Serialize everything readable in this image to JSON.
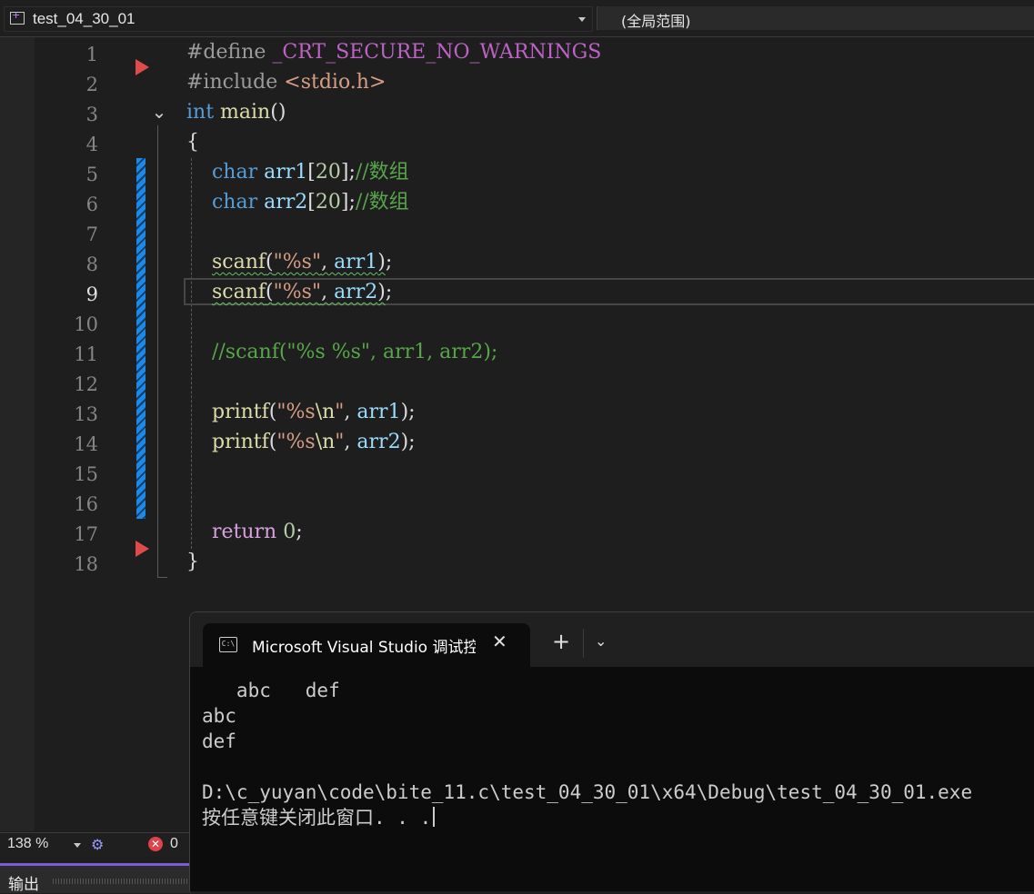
{
  "navbar": {
    "project": "test_04_30_01",
    "scope": "(全局范围)"
  },
  "editor": {
    "line_numbers": [
      "1",
      "2",
      "3",
      "4",
      "5",
      "6",
      "7",
      "8",
      "9",
      "10",
      "11",
      "12",
      "13",
      "14",
      "15",
      "16",
      "17",
      "18"
    ],
    "current_line": "9",
    "lines": [
      [
        {
          "t": "#define ",
          "c": "pp"
        },
        {
          "t": "_CRT_SECURE_NO_WARNINGS",
          "c": "macro"
        }
      ],
      [
        {
          "t": "#include ",
          "c": "pp"
        },
        {
          "t": "<stdio.h>",
          "c": "str"
        }
      ],
      [
        {
          "t": "int",
          "c": "kw"
        },
        {
          "t": " "
        },
        {
          "t": "main",
          "c": "fn"
        },
        {
          "t": "()"
        }
      ],
      [
        {
          "t": "{"
        }
      ],
      [
        {
          "t": "    "
        },
        {
          "t": "char",
          "c": "kw"
        },
        {
          "t": " "
        },
        {
          "t": "arr1",
          "c": "var"
        },
        {
          "t": "["
        },
        {
          "t": "20",
          "c": "num"
        },
        {
          "t": "];"
        },
        {
          "t": "//数组",
          "c": "cmt"
        }
      ],
      [
        {
          "t": "    "
        },
        {
          "t": "char",
          "c": "kw"
        },
        {
          "t": " "
        },
        {
          "t": "arr2",
          "c": "var"
        },
        {
          "t": "["
        },
        {
          "t": "20",
          "c": "num"
        },
        {
          "t": "];"
        },
        {
          "t": "//数组",
          "c": "cmt"
        }
      ],
      [],
      [
        {
          "t": "    "
        },
        {
          "t": "scanf",
          "c": "fn squig"
        },
        {
          "t": "(",
          "c": "squig"
        },
        {
          "t": "\"%s\"",
          "c": "str squig"
        },
        {
          "t": ", ",
          "c": "squig"
        },
        {
          "t": "arr1",
          "c": "var squig"
        },
        {
          "t": ")",
          "c": "squig"
        },
        {
          "t": ";"
        }
      ],
      [
        {
          "t": "    "
        },
        {
          "t": "scanf",
          "c": "fn squig"
        },
        {
          "t": "(",
          "c": "squig"
        },
        {
          "t": "\"%s\"",
          "c": "str squig"
        },
        {
          "t": ", ",
          "c": "squig"
        },
        {
          "t": "arr2",
          "c": "var squig"
        },
        {
          "t": ")",
          "c": "squig"
        },
        {
          "t": ";"
        }
      ],
      [],
      [
        {
          "t": "    "
        },
        {
          "t": "//scanf(\"%s %s\", arr1, arr2);",
          "c": "cmt"
        }
      ],
      [],
      [
        {
          "t": "    "
        },
        {
          "t": "printf",
          "c": "fn"
        },
        {
          "t": "("
        },
        {
          "t": "\"%s",
          "c": "str"
        },
        {
          "t": "\\n",
          "c": "fn"
        },
        {
          "t": "\"",
          "c": "str"
        },
        {
          "t": ", "
        },
        {
          "t": "arr1",
          "c": "var"
        },
        {
          "t": ");"
        }
      ],
      [
        {
          "t": "    "
        },
        {
          "t": "printf",
          "c": "fn"
        },
        {
          "t": "("
        },
        {
          "t": "\"%s",
          "c": "str"
        },
        {
          "t": "\\n",
          "c": "fn"
        },
        {
          "t": "\"",
          "c": "str"
        },
        {
          "t": ", "
        },
        {
          "t": "arr2",
          "c": "var"
        },
        {
          "t": ");"
        }
      ],
      [],
      [],
      [
        {
          "t": "    "
        },
        {
          "t": "return",
          "c": "ret"
        },
        {
          "t": " "
        },
        {
          "t": "0",
          "c": "num"
        },
        {
          "t": ";"
        }
      ],
      [
        {
          "t": "}"
        }
      ]
    ]
  },
  "statusbar": {
    "zoom": "138 %",
    "error_count": "0"
  },
  "output_panel": {
    "tab_label": "输出"
  },
  "console": {
    "tab_title": "Microsoft Visual Studio 调试控制台",
    "output_lines": [
      "   abc   def",
      "abc",
      "def",
      "",
      "D:\\c_yuyan\\code\\bite_11.c\\test_04_30_01\\x64\\Debug\\test_04_30_01.exe",
      "按任意键关闭此窗口. . ."
    ]
  },
  "colors": {
    "keyword": "#569cd6",
    "function": "#dcdcaa",
    "variable": "#9cdcfe",
    "string": "#d69d85",
    "comment": "#57a64a",
    "macro": "#bd63c5",
    "breakpoint": "#e04a4a",
    "change_bar": "#1e88e5"
  },
  "icons": {
    "project": "cpp-project-icon",
    "breakpoint": "breakpoint-arrow-icon",
    "fold": "chevron-down-icon",
    "intellicode": "intellicode-icon",
    "error": "error-icon",
    "console": "terminal-icon",
    "close": "close-icon",
    "new_tab": "plus-icon",
    "tab_dropdown": "chevron-down-icon"
  }
}
